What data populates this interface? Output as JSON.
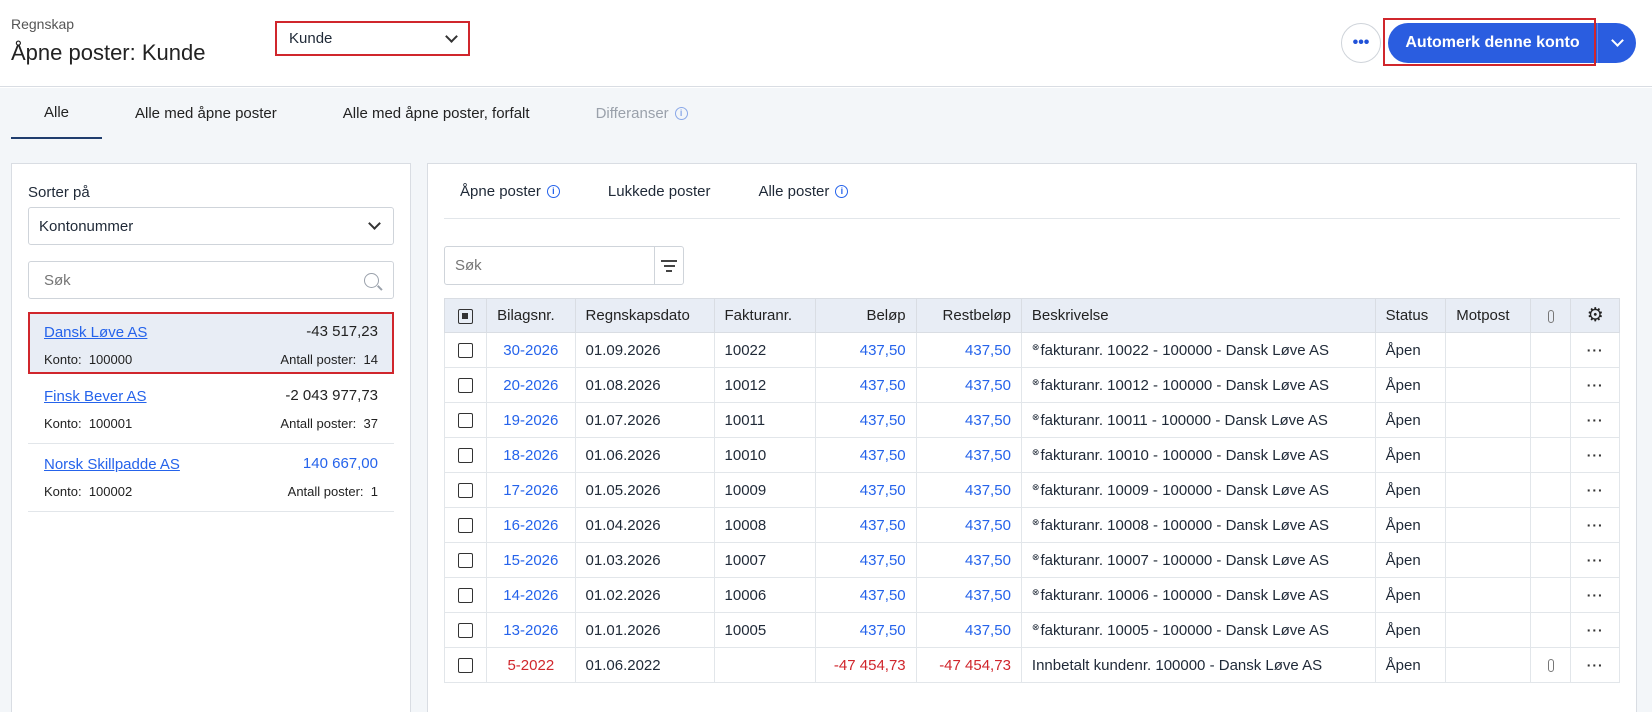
{
  "header": {
    "breadcrumb": "Regnskap",
    "title": "Åpne poster: Kunde",
    "type_select": "Kunde",
    "more_label": "•••",
    "primary_button": "Automerk denne konto"
  },
  "tabs": [
    {
      "label": "Alle"
    },
    {
      "label": "Alle med åpne poster"
    },
    {
      "label": "Alle med åpne poster, forfalt"
    },
    {
      "label": "Differanser"
    }
  ],
  "left": {
    "sort_label": "Sorter på",
    "sort_value": "Kontonummer",
    "search_placeholder": "Søk",
    "konto_label": "Konto:",
    "count_label": "Antall poster:",
    "accounts": [
      {
        "name": "Dansk Løve AS",
        "balance": "-43 517,23",
        "konto": "100000",
        "count": "14"
      },
      {
        "name": "Finsk Bever AS",
        "balance": "-2 043 977,73",
        "konto": "100001",
        "count": "37"
      },
      {
        "name": "Norsk Skillpadde AS",
        "balance": "140 667,00",
        "konto": "100002",
        "count": "1"
      }
    ]
  },
  "right": {
    "sub_tabs": [
      {
        "label": "Åpne poster"
      },
      {
        "label": "Lukkede poster"
      },
      {
        "label": "Alle poster"
      }
    ],
    "search_placeholder": "Søk",
    "columns": {
      "bilag": "Bilagsnr.",
      "dato": "Regnskapsdato",
      "faktura": "Fakturanr.",
      "belop": "Beløp",
      "rest": "Restbeløp",
      "beskrivelse": "Beskrivelse",
      "status": "Status",
      "motpost": "Motpost"
    },
    "rows": [
      {
        "bilag": "30-2026",
        "dato": "01.09.2026",
        "faktura": "10022",
        "belop": "437,50",
        "rest": "437,50",
        "beskrivelse": "fakturanr. 10022 - 100000 - Dansk Løve AS",
        "status": "Åpen"
      },
      {
        "bilag": "20-2026",
        "dato": "01.08.2026",
        "faktura": "10012",
        "belop": "437,50",
        "rest": "437,50",
        "beskrivelse": "fakturanr. 10012 - 100000 - Dansk Løve AS",
        "status": "Åpen"
      },
      {
        "bilag": "19-2026",
        "dato": "01.07.2026",
        "faktura": "10011",
        "belop": "437,50",
        "rest": "437,50",
        "beskrivelse": "fakturanr. 10011 - 100000 - Dansk Løve AS",
        "status": "Åpen"
      },
      {
        "bilag": "18-2026",
        "dato": "01.06.2026",
        "faktura": "10010",
        "belop": "437,50",
        "rest": "437,50",
        "beskrivelse": "fakturanr. 10010 - 100000 - Dansk Løve AS",
        "status": "Åpen"
      },
      {
        "bilag": "17-2026",
        "dato": "01.05.2026",
        "faktura": "10009",
        "belop": "437,50",
        "rest": "437,50",
        "beskrivelse": "fakturanr. 10009 - 100000 - Dansk Løve AS",
        "status": "Åpen"
      },
      {
        "bilag": "16-2026",
        "dato": "01.04.2026",
        "faktura": "10008",
        "belop": "437,50",
        "rest": "437,50",
        "beskrivelse": "fakturanr. 10008 - 100000 - Dansk Løve AS",
        "status": "Åpen"
      },
      {
        "bilag": "15-2026",
        "dato": "01.03.2026",
        "faktura": "10007",
        "belop": "437,50",
        "rest": "437,50",
        "beskrivelse": "fakturanr. 10007 - 100000 - Dansk Løve AS",
        "status": "Åpen"
      },
      {
        "bilag": "14-2026",
        "dato": "01.02.2026",
        "faktura": "10006",
        "belop": "437,50",
        "rest": "437,50",
        "beskrivelse": "fakturanr. 10006 - 100000 - Dansk Løve AS",
        "status": "Åpen"
      },
      {
        "bilag": "13-2026",
        "dato": "01.01.2026",
        "faktura": "10005",
        "belop": "437,50",
        "rest": "437,50",
        "beskrivelse": "fakturanr. 10005 - 100000 - Dansk Løve AS",
        "status": "Åpen"
      },
      {
        "bilag": "5-2022",
        "dato": "01.06.2022",
        "faktura": "",
        "belop": "-47 454,73",
        "rest": "-47 454,73",
        "beskrivelse": "Innbetalt kundenr. 100000 - Dansk Løve AS",
        "status": "Åpen"
      }
    ]
  }
}
